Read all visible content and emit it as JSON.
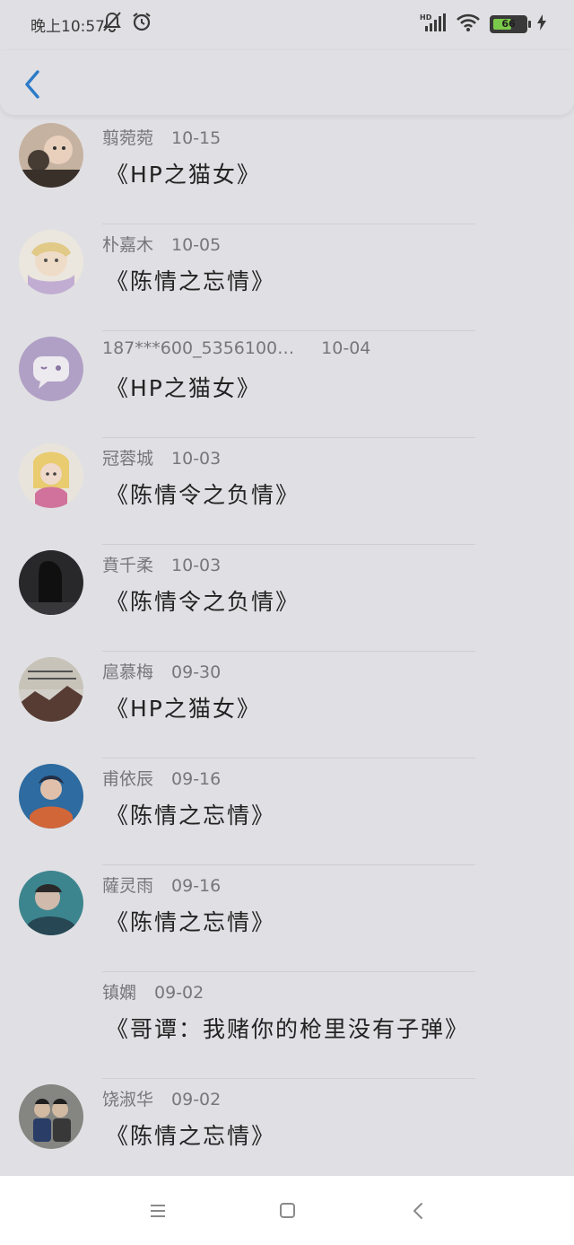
{
  "status_bar": {
    "time": "晚上10:57",
    "battery_level": "66",
    "battery_fraction": 0.66,
    "icons": [
      "mute-bell-icon",
      "alarm-icon",
      "hd-signal-icon",
      "wifi-icon",
      "battery-icon",
      "charging-icon"
    ]
  },
  "header": {
    "back_icon": "back-arrow-icon"
  },
  "comments": [
    {
      "name": "翦菀菀",
      "date": "10-15",
      "title": "《HP之猫女》",
      "avatar": "photo"
    },
    {
      "name": "朴嘉木",
      "date": "10-05",
      "title": "《陈情之忘情》",
      "avatar": "anime"
    },
    {
      "name": "187***600_5356100…",
      "date": "10-04",
      "title": "《HP之猫女》",
      "avatar": "default-chat"
    },
    {
      "name": "冠蓉城",
      "date": "10-03",
      "title": "《陈情令之负情》",
      "avatar": "anime-girl"
    },
    {
      "name": "賁千柔",
      "date": "10-03",
      "title": "《陈情令之负情》",
      "avatar": "dark"
    },
    {
      "name": "扈慕梅",
      "date": "09-30",
      "title": "《HP之猫女》",
      "avatar": "landscape"
    },
    {
      "name": "甫依辰",
      "date": "09-16",
      "title": "《陈情之忘情》",
      "avatar": "portrait-blue"
    },
    {
      "name": "薩灵雨",
      "date": "09-16",
      "title": "《陈情之忘情》",
      "avatar": "teal"
    },
    {
      "name": "镇嫻",
      "date": "09-02",
      "title": "《哥谭：我赌你的枪里没有子弹》",
      "avatar": "none"
    },
    {
      "name": "饶淑华",
      "date": "09-02",
      "title": "《陈情之忘情》",
      "avatar": "kids"
    }
  ],
  "nav_bar": {
    "icons": [
      "menu-icon",
      "home-square-icon",
      "back-chevron-icon"
    ]
  }
}
